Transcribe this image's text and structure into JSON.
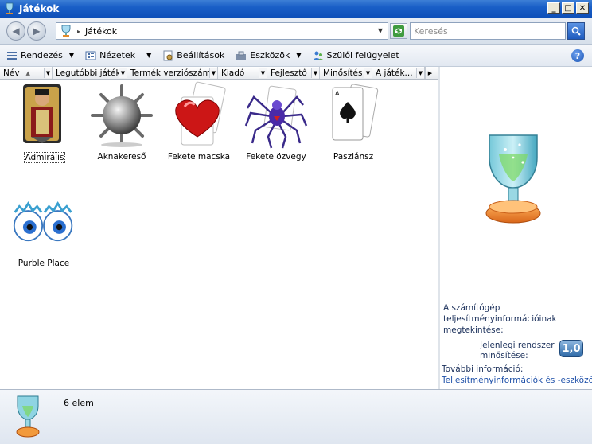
{
  "window": {
    "title": "Játékok"
  },
  "address": {
    "path": "Játékok",
    "separator": "▸"
  },
  "search": {
    "placeholder": "Keresés"
  },
  "toolbar": {
    "organize": "Rendezés",
    "views": "Nézetek",
    "settings": "Beállítások",
    "tools": "Eszközök",
    "parental": "Szülői felügyelet"
  },
  "columns": [
    "Név",
    "Legutóbbi játék",
    "Termék verziószáma",
    "Kiadó",
    "Fejlesztő",
    "Minősítés",
    "A játék..."
  ],
  "games": [
    {
      "name": "Admirális",
      "icon": "freecell-icon"
    },
    {
      "name": "Aknakereső",
      "icon": "minesweeper-icon"
    },
    {
      "name": "Fekete macska",
      "icon": "hearts-icon"
    },
    {
      "name": "Fekete özvegy",
      "icon": "spider-solitaire-icon"
    },
    {
      "name": "Pasziánsz",
      "icon": "solitaire-icon"
    },
    {
      "name": "Purble Place",
      "icon": "purble-place-icon"
    }
  ],
  "rightpane": {
    "title": "A számítógép teljesítményinformációinak megtekintése:",
    "rating_label": "Jelenlegi rendszer minősítése:",
    "rating_value": "1,0",
    "more_label": "További információ:",
    "link": "Teljesítményinformációk és -eszközök"
  },
  "details": {
    "count": "6 elem"
  }
}
